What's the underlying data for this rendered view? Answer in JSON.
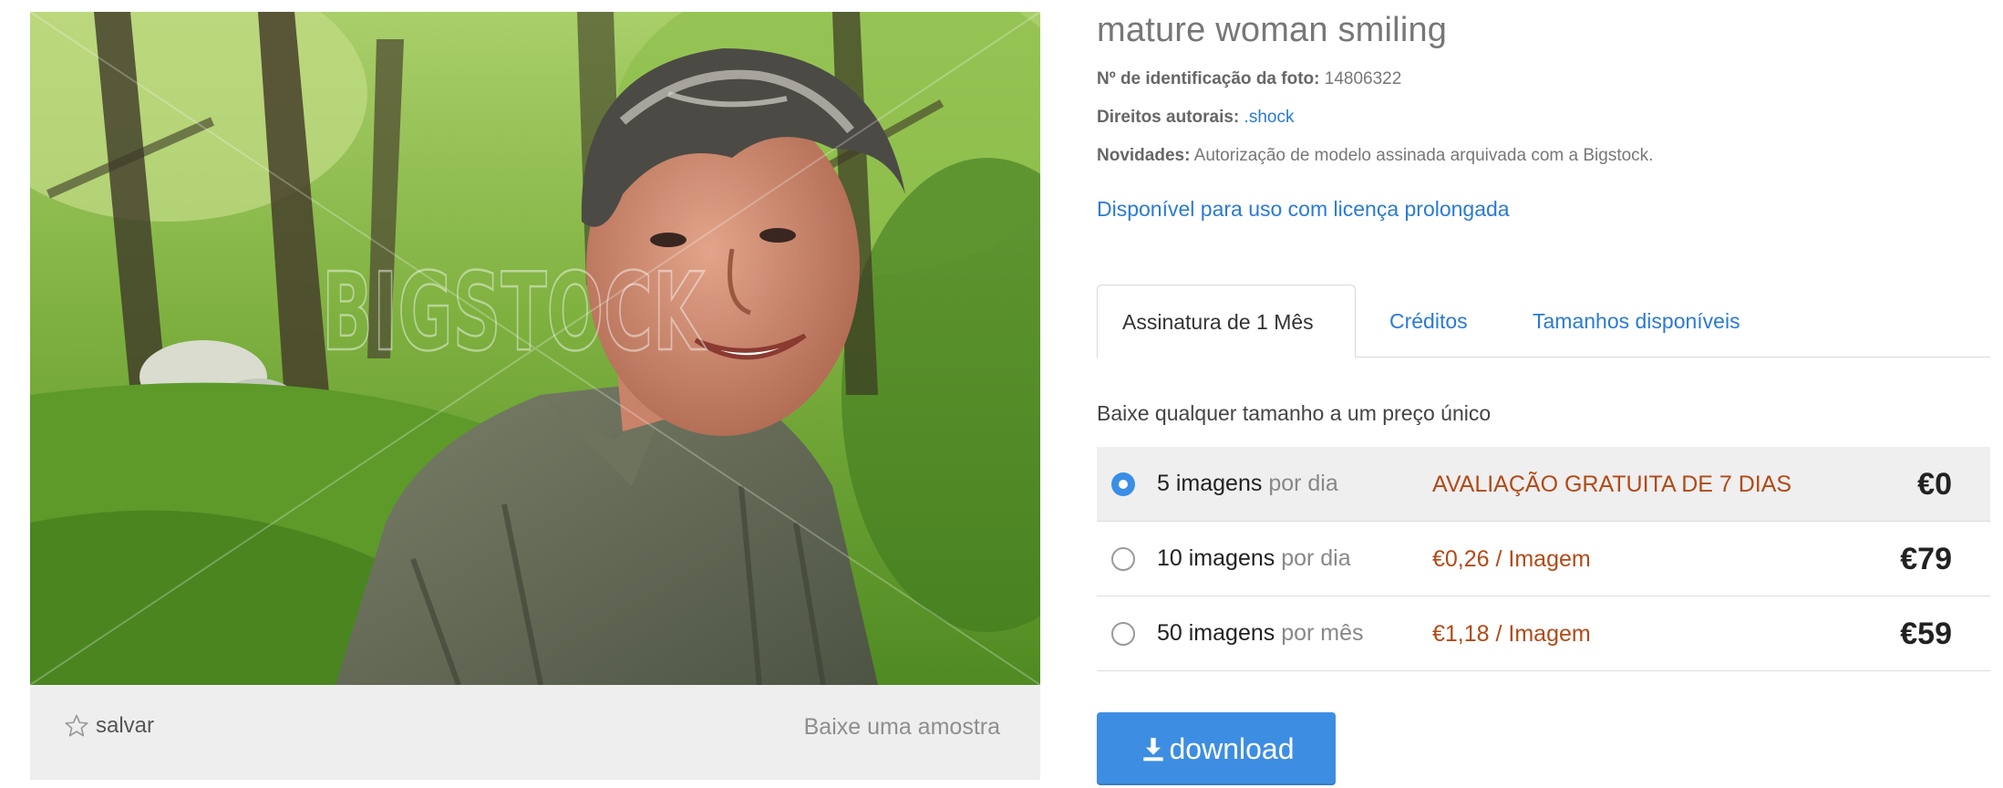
{
  "photo": {
    "watermark": "BIGSTOCK",
    "save_label": "salvar",
    "sample_label": "Baixe uma amostra"
  },
  "info": {
    "title": "mature woman smiling",
    "id_label": "Nº de identificação da foto:",
    "id_value": "14806322",
    "copyright_label": "Direitos autorais:",
    "copyright_value": ".shock",
    "news_label": "Novidades:",
    "news_value": "Autorização de modelo assinada arquivada com a Bigstock.",
    "extended_license": "Disponível para uso com licença prolongada"
  },
  "tabs": [
    {
      "label": "Assinatura de 1 Mês",
      "active": true
    },
    {
      "label": "Créditos",
      "active": false
    },
    {
      "label": "Tamanhos disponíveis",
      "active": false
    }
  ],
  "tagline": "Baixe qualquer tamanho a um preço único",
  "plans": [
    {
      "qty": "5 imagens",
      "per": "por dia",
      "offer": "AVALIAÇÃO GRATUITA DE 7 DIAS",
      "price": "€0",
      "selected": true
    },
    {
      "qty": "10 imagens",
      "per": "por dia",
      "offer": "€0,26 / Imagem",
      "price": "€79",
      "selected": false
    },
    {
      "qty": "50 imagens",
      "per": "por mês",
      "offer": "€1,18 / Imagem",
      "price": "€59",
      "selected": false
    }
  ],
  "download_label": "download",
  "colors": {
    "link": "#2a7ad7",
    "offer": "#b24a17",
    "button": "#3d8ee2",
    "selected_row": "#efefef",
    "radio_on": "#3a8ee6"
  }
}
